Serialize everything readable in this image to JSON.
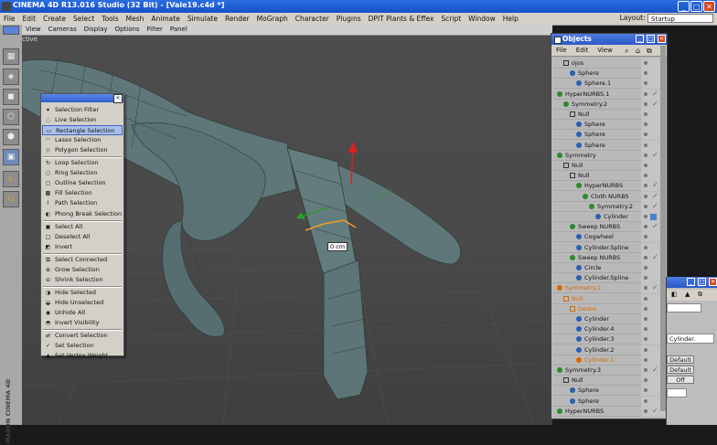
{
  "window": {
    "title": "CINEMA 4D R13.016 Studio (32 Bit) - [Vale19.c4d *]"
  },
  "menubar": {
    "items": [
      "File",
      "Edit",
      "Create",
      "Select",
      "Tools",
      "Mesh",
      "Animate",
      "Simulate",
      "Render",
      "MoGraph",
      "Character",
      "Plugins",
      "DPIT Plants & Effex",
      "Script",
      "Window",
      "Help"
    ],
    "layout_label": "Layout:",
    "layout_value": "Startup"
  },
  "viewport": {
    "menu": [
      "View",
      "Cameras",
      "Display",
      "Options",
      "Filter",
      "Panel"
    ],
    "label": "ctive",
    "measure": "0 cm",
    "corner_text": "MAXON CINEMA 4D"
  },
  "selection_menu": {
    "items": [
      {
        "label": "Selection Filter",
        "icon": "filter-icon",
        "highlighted": false
      },
      {
        "label": "Live Selection",
        "icon": "live-select-icon",
        "highlighted": false
      },
      {
        "label": "Rectangle Selection",
        "icon": "rect-select-icon",
        "highlighted": true
      },
      {
        "label": "Lasso Selection",
        "icon": "lasso-icon",
        "highlighted": false
      },
      {
        "label": "Polygon Selection",
        "icon": "polygon-select-icon",
        "highlighted": false
      },
      {
        "label": "Loop Selection",
        "icon": "loop-icon",
        "highlighted": false,
        "sep": true
      },
      {
        "label": "Ring Selection",
        "icon": "ring-icon",
        "highlighted": false
      },
      {
        "label": "Outline Selection",
        "icon": "outline-icon",
        "highlighted": false
      },
      {
        "label": "Fill Selection",
        "icon": "fill-icon",
        "highlighted": false
      },
      {
        "label": "Path Selection",
        "icon": "path-icon",
        "highlighted": false
      },
      {
        "label": "Phong Break Selection",
        "icon": "phong-icon",
        "highlighted": false
      },
      {
        "label": "Select All",
        "icon": "select-all-icon",
        "highlighted": false,
        "sep": true
      },
      {
        "label": "Deselect All",
        "icon": "deselect-all-icon",
        "highlighted": false
      },
      {
        "label": "Invert",
        "icon": "invert-icon",
        "highlighted": false
      },
      {
        "label": "Select Connected",
        "icon": "connected-icon",
        "highlighted": false,
        "sep": true
      },
      {
        "label": "Grow Selection",
        "icon": "grow-icon",
        "highlighted": false
      },
      {
        "label": "Shrink Selection",
        "icon": "shrink-icon",
        "highlighted": false
      },
      {
        "label": "Hide Selected",
        "icon": "hide-icon",
        "highlighted": false,
        "sep": true
      },
      {
        "label": "Hide Unselected",
        "icon": "hide-unselected-icon",
        "highlighted": false
      },
      {
        "label": "Unhide All",
        "icon": "unhide-icon",
        "highlighted": false
      },
      {
        "label": "Invert Visibility",
        "icon": "invert-visibility-icon",
        "highlighted": false
      },
      {
        "label": "Convert Selection",
        "icon": "convert-icon",
        "highlighted": false,
        "sep": true
      },
      {
        "label": "Set Selection",
        "icon": "set-selection-icon",
        "highlighted": false
      },
      {
        "label": "Set Vertex Weight...",
        "icon": "vertex-weight-icon",
        "highlighted": false
      }
    ]
  },
  "objects": {
    "title": "Objects",
    "menu": [
      "File",
      "Edit",
      "View"
    ],
    "rows": [
      {
        "name": "ojos",
        "depth": 1,
        "icon": "null",
        "color": "#333",
        "status": "dot"
      },
      {
        "name": "Sphere",
        "depth": 2,
        "icon": "sphere",
        "color": "#2c5fb0",
        "status": "dot"
      },
      {
        "name": "Sphere.1",
        "depth": 3,
        "icon": "sphere",
        "color": "#2c5fb0",
        "status": "dot"
      },
      {
        "name": "HyperNURBS.1",
        "depth": 0,
        "icon": "nurbs",
        "color": "#2b8a2b",
        "status": "check"
      },
      {
        "name": "Symmetry.2",
        "depth": 1,
        "icon": "symmetry",
        "color": "#2b8a2b",
        "status": "check"
      },
      {
        "name": "Null",
        "depth": 2,
        "icon": "null",
        "color": "#333",
        "status": "dot"
      },
      {
        "name": "Sphere",
        "depth": 3,
        "icon": "sphere",
        "color": "#2c5fb0",
        "status": "dot"
      },
      {
        "name": "Sphere",
        "depth": 3,
        "icon": "sphere",
        "color": "#2c5fb0",
        "status": "dot"
      },
      {
        "name": "Sphere",
        "depth": 3,
        "icon": "sphere",
        "color": "#2c5fb0",
        "status": "dot"
      },
      {
        "name": "Symmetry",
        "depth": 0,
        "icon": "symmetry",
        "color": "#2b8a2b",
        "status": "check"
      },
      {
        "name": "Null",
        "depth": 1,
        "icon": "null",
        "color": "#333",
        "status": "dot"
      },
      {
        "name": "Null",
        "depth": 2,
        "icon": "null",
        "color": "#333",
        "status": "dot"
      },
      {
        "name": "HyperNURBS",
        "depth": 3,
        "icon": "nurbs",
        "color": "#2b8a2b",
        "status": "check"
      },
      {
        "name": "Cloth NURBS",
        "depth": 4,
        "icon": "nurbs",
        "color": "#2b8a2b",
        "status": "check"
      },
      {
        "name": "Symmetry.2",
        "depth": 5,
        "icon": "symmetry",
        "color": "#2b8a2b",
        "status": "check"
      },
      {
        "name": "Cylinder",
        "depth": 6,
        "icon": "cylinder",
        "color": "#2c5fb0",
        "status": "tag"
      },
      {
        "name": "Sweep NURBS",
        "depth": 2,
        "icon": "nurbs",
        "color": "#2b8a2b",
        "status": "check"
      },
      {
        "name": "Cogwheel",
        "depth": 3,
        "icon": "spline",
        "color": "#2c5fb0",
        "status": "dot"
      },
      {
        "name": "Cylinder.Spline",
        "depth": 3,
        "icon": "spline",
        "color": "#2c5fb0",
        "status": "dot"
      },
      {
        "name": "Sweep NURBS",
        "depth": 2,
        "icon": "nurbs",
        "color": "#2b8a2b",
        "status": "check"
      },
      {
        "name": "Circle",
        "depth": 3,
        "icon": "spline",
        "color": "#2c5fb0",
        "status": "dot"
      },
      {
        "name": "Cylinder.Spline",
        "depth": 3,
        "icon": "spline",
        "color": "#2c5fb0",
        "status": "dot"
      },
      {
        "name": "Symmetry.1",
        "depth": 0,
        "icon": "symmetry",
        "color": "#d46a00",
        "status": "check",
        "orange": true
      },
      {
        "name": "Null",
        "depth": 1,
        "icon": "null",
        "color": "#d46a00",
        "status": "dot",
        "orange": true
      },
      {
        "name": "Dedos",
        "depth": 2,
        "icon": "null",
        "color": "#d46a00",
        "status": "dot",
        "orange": true
      },
      {
        "name": "Cylinder",
        "depth": 3,
        "icon": "cylinder",
        "color": "#2c5fb0",
        "status": "dot"
      },
      {
        "name": "Cylinder.4",
        "depth": 3,
        "icon": "cylinder",
        "color": "#2c5fb0",
        "status": "dot"
      },
      {
        "name": "Cylinder.3",
        "depth": 3,
        "icon": "cylinder",
        "color": "#2c5fb0",
        "status": "dot"
      },
      {
        "name": "Cylinder.2",
        "depth": 3,
        "icon": "cylinder",
        "color": "#2c5fb0",
        "status": "dot"
      },
      {
        "name": "Cylinder.1",
        "depth": 3,
        "icon": "cylinder",
        "color": "#d46a00",
        "status": "dot",
        "orange": true
      },
      {
        "name": "Symmetry.3",
        "depth": 0,
        "icon": "symmetry",
        "color": "#2b8a2b",
        "status": "check"
      },
      {
        "name": "Null",
        "depth": 1,
        "icon": "null",
        "color": "#333",
        "status": "dot"
      },
      {
        "name": "Sphere",
        "depth": 2,
        "icon": "sphere",
        "color": "#2c5fb0",
        "status": "dot"
      },
      {
        "name": "Sphere",
        "depth": 2,
        "icon": "sphere",
        "color": "#2c5fb0",
        "status": "dot"
      },
      {
        "name": "HyperNURBS",
        "depth": 0,
        "icon": "nurbs",
        "color": "#2b8a2b",
        "status": "check"
      }
    ]
  },
  "attributes": {
    "name_value": "Cylinder.",
    "buttons": [
      "Default",
      "Default",
      "Off"
    ]
  }
}
